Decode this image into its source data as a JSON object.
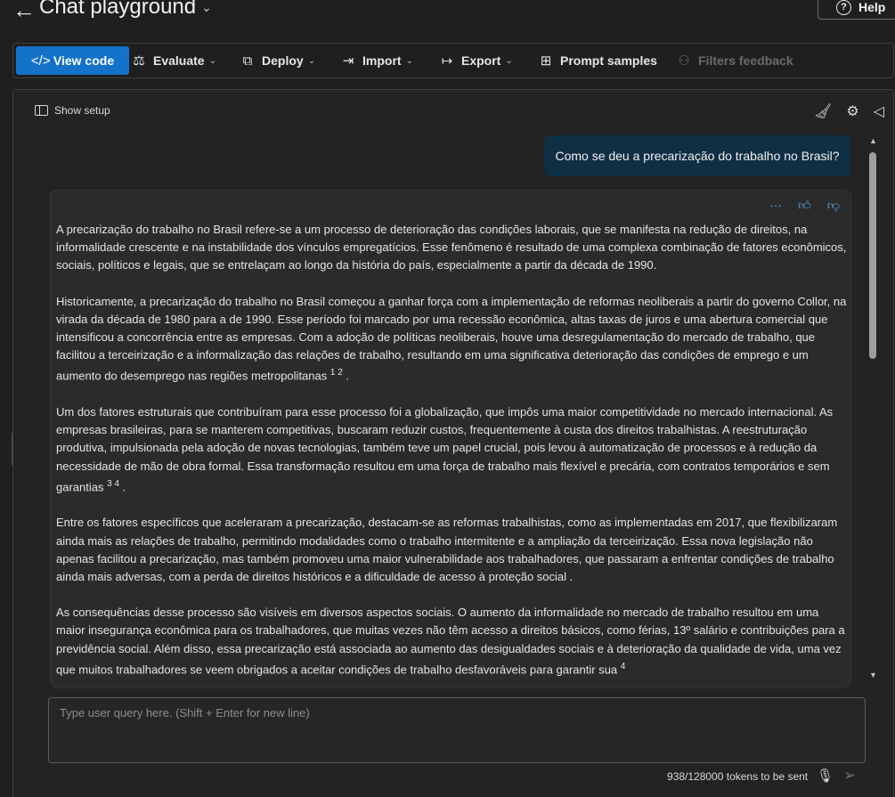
{
  "header": {
    "back_glyph": "←",
    "title": "Chat playground",
    "help_label": "Help"
  },
  "toolbar": {
    "view_code": "View code",
    "evaluate": "Evaluate",
    "deploy": "Deploy",
    "import": "Import",
    "export": "Export",
    "prompt_samples": "Prompt samples",
    "filters_feedback": "Filters feedback"
  },
  "panel": {
    "show_setup": "Show setup"
  },
  "conversation": {
    "user_message": "Como se deu a precarização do trabalho no Brasil?",
    "assistant_paragraphs": [
      "A precarização do trabalho no Brasil refere-se a um processo de deterioração das condições laborais, que se manifesta na redução de direitos, na informalidade crescente e na instabilidade dos vínculos empregatícios. Esse fenômeno é resultado de uma complexa combinação de fatores econômicos, sociais, políticos e legais, que se entrelaçam ao longo da história do país, especialmente a partir da década de 1990.",
      "Historicamente, a precarização do trabalho no Brasil começou a ganhar força com a implementação de reformas neoliberais a partir do governo Collor, na virada da década de 1980 para a de 1990. Esse período foi marcado por uma recessão econômica, altas taxas de juros e uma abertura comercial que intensificou a concorrência entre as empresas. Com a adoção de políticas neoliberais, houve uma desregulamentação do mercado de trabalho, que facilitou a terceirização e a informalização das relações de trabalho, resultando em uma significativa deterioração das condições de emprego e um aumento do desemprego nas regiões metropolitanas",
      "Um dos fatores estruturais que contribuíram para esse processo foi a globalização, que impôs uma maior competitividade no mercado internacional. As empresas brasileiras, para se manterem competitivas, buscaram reduzir custos, frequentemente à custa dos direitos trabalhistas. A reestruturação produtiva, impulsionada pela adoção de novas tecnologias, também teve um papel crucial, pois levou à automatização de processos e à redução da necessidade de mão de obra formal. Essa transformação resultou em uma força de trabalho mais flexível e precária, com contratos temporários e sem garantias",
      "Entre os fatores específicos que aceleraram a precarização, destacam-se as reformas trabalhistas, como as implementadas em 2017, que flexibilizaram ainda mais as relações de trabalho, permitindo modalidades como o trabalho intermitente e a ampliação da terceirização. Essa nova legislação não apenas facilitou a precarização, mas também promoveu uma maior vulnerabilidade aos trabalhadores, que passaram a enfrentar condições de trabalho ainda mais adversas, com a perda de direitos históricos e a dificuldade de acesso à proteção social .",
      "As consequências desse processo são visíveis em diversos aspectos sociais. O aumento da informalidade no mercado de trabalho resultou em uma maior insegurança econômica para os trabalhadores, que muitas vezes não têm acesso a direitos básicos, como férias, 13º salário e contribuições para a previdência social. Além disso, essa precarização está associada ao aumento das desigualdades sociais e à deterioração da qualidade de vida, uma vez que muitos trabalhadores se veem obrigados a aceitar condições de trabalho desfavoráveis para garantir sua"
    ],
    "citations": {
      "p2": "1 2",
      "p3": "3 4",
      "p5": "4"
    }
  },
  "input": {
    "placeholder": "Type user query here. (Shift + Enter for new line)",
    "value": ""
  },
  "footer": {
    "tokens": "938/128000 tokens to be sent"
  },
  "icons": {
    "back": "arrow-left-icon",
    "help": "question-circle-icon",
    "view_code": "code-icon",
    "evaluate": "scale-icon",
    "deploy": "cube-icon",
    "import": "import-arrow-icon",
    "export": "export-arrow-icon",
    "prompt_samples": "grid-icon",
    "filters_feedback": "people-icon",
    "clear": "broom-icon",
    "settings": "gear-icon",
    "speaker": "speaker-icon",
    "more": "ellipsis-icon",
    "thumbs_up": "thumbs-up-icon",
    "thumbs_down": "thumbs-down-icon",
    "mic": "microphone-icon",
    "send": "send-icon"
  },
  "colors": {
    "accent": "#1473c9",
    "user_bubble": "#0f2f45",
    "background": "#1f1f1f"
  }
}
